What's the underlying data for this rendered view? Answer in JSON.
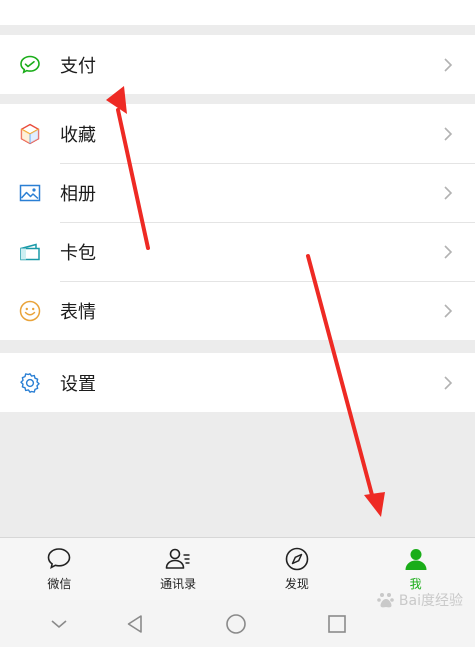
{
  "menu_groups": [
    {
      "items": [
        {
          "label": "支付",
          "icon": "wechat-pay-icon"
        }
      ]
    },
    {
      "items": [
        {
          "label": "收藏",
          "icon": "favorites-cube-icon"
        },
        {
          "label": "相册",
          "icon": "album-image-icon"
        },
        {
          "label": "卡包",
          "icon": "card-wallet-icon"
        },
        {
          "label": "表情",
          "icon": "sticker-smiley-icon"
        }
      ]
    },
    {
      "items": [
        {
          "label": "设置",
          "icon": "settings-gear-icon"
        }
      ]
    }
  ],
  "tabbar": {
    "tabs": [
      {
        "label": "微信",
        "icon": "chat-bubble-icon",
        "active": false
      },
      {
        "label": "通讯录",
        "icon": "contacts-icon",
        "active": false
      },
      {
        "label": "发现",
        "icon": "compass-icon",
        "active": false
      },
      {
        "label": "我",
        "icon": "person-icon",
        "active": true
      }
    ]
  },
  "system_nav": [
    "back-chevron-icon",
    "back-triangle-icon",
    "home-circle-icon",
    "recents-square-icon"
  ],
  "watermark": {
    "text": "Bai度经验",
    "icon": "baidu-paw-icon"
  },
  "colors": {
    "background": "#ececec",
    "active_tab": "#1aad19",
    "wechat_green": "#1aad19",
    "annotation_arrow": "#ee2a24"
  }
}
